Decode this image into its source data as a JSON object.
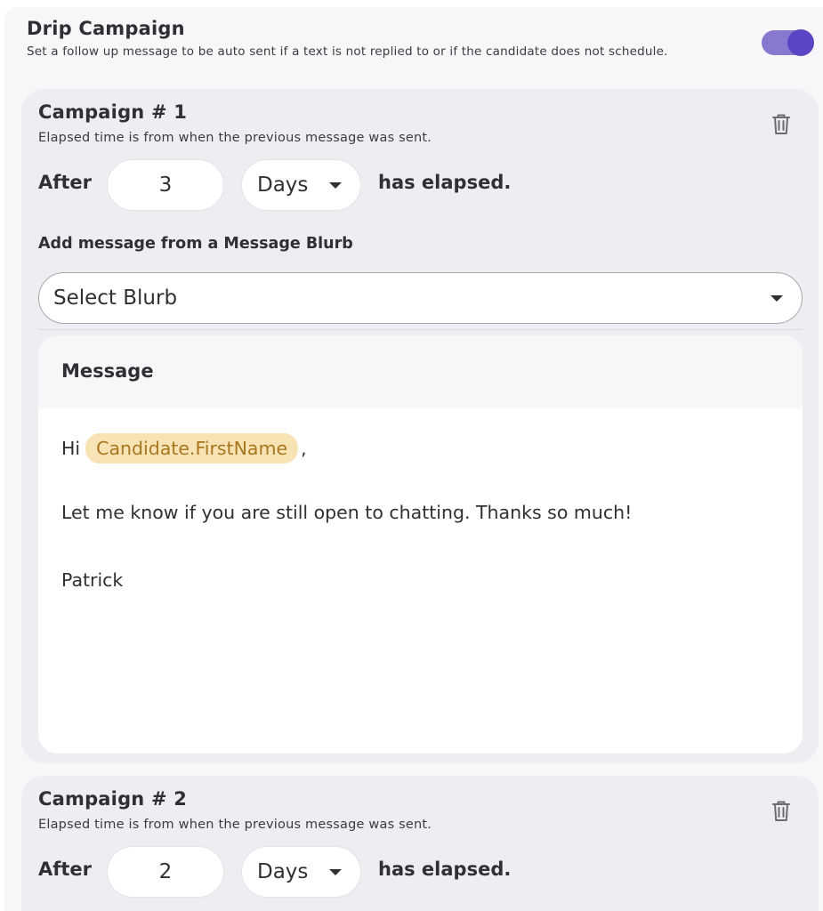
{
  "drip": {
    "title": "Drip Campaign",
    "subtitle": "Set a follow up message to be auto sent if a text is not replied to or if the candidate does not schedule.",
    "toggle_on": true,
    "accent": "#5b45c4"
  },
  "campaigns": [
    {
      "title": "Campaign # 1",
      "subtitle": "Elapsed time is from when the previous message was sent.",
      "after_label": "After",
      "amount": "3",
      "unit": "Days",
      "elapsed_label": "has elapsed.",
      "blurb_label": "Add message from a Message Blurb",
      "blurb_placeholder": "Select Blurb",
      "message_header": "Message",
      "message": {
        "greeting": "Hi",
        "token": "Candidate.FirstName",
        "comma": ",",
        "body": "Let me know if you are still open to chatting. Thanks so much!",
        "signature": "Patrick"
      },
      "token_color": "#a7761e"
    },
    {
      "title": "Campaign # 2",
      "subtitle": "Elapsed time is from when the previous message was sent.",
      "after_label": "After",
      "amount": "2",
      "unit": "Days",
      "elapsed_label": "has elapsed."
    }
  ],
  "icons": {
    "delete": "trash-icon",
    "dropdown": "caret-down-icon"
  }
}
